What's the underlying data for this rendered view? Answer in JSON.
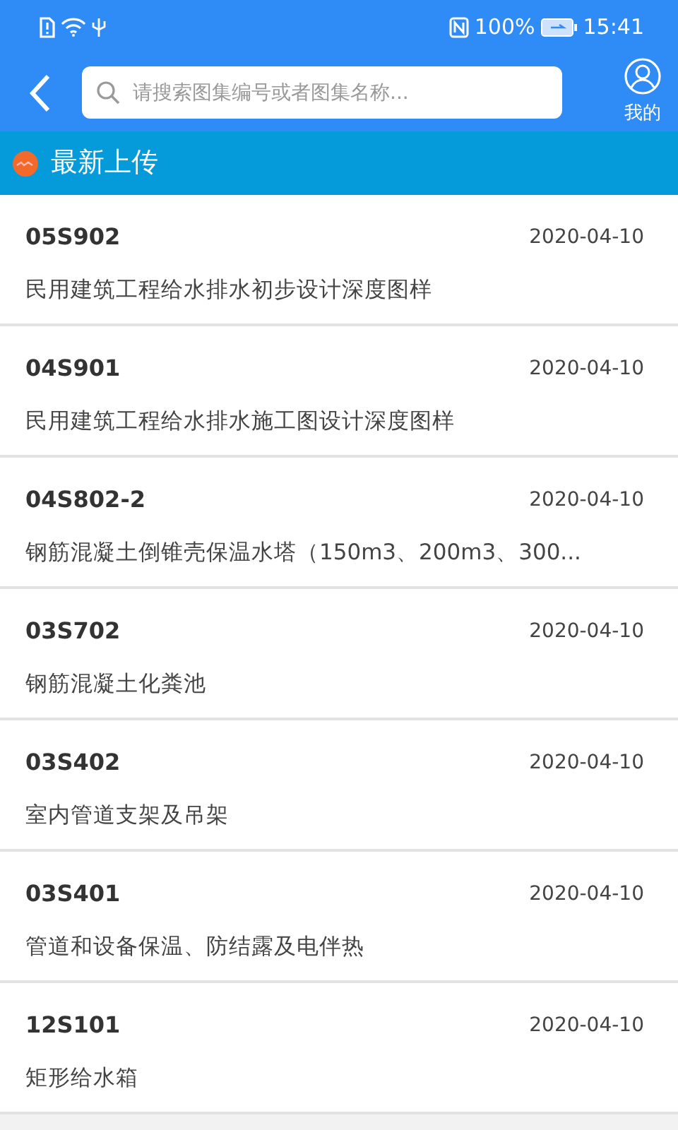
{
  "status_bar": {
    "battery_text": "100%",
    "time": "15:41"
  },
  "header": {
    "search": {
      "placeholder": "请搜索图集编号或者图集名称..."
    },
    "profile_label": "我的"
  },
  "section": {
    "title": "最新上传"
  },
  "items": [
    {
      "code": "05S902",
      "date": "2020-04-10",
      "title": "民用建筑工程给水排水初步设计深度图样"
    },
    {
      "code": "04S901",
      "date": "2020-04-10",
      "title": "民用建筑工程给水排水施工图设计深度图样"
    },
    {
      "code": "04S802-2",
      "date": "2020-04-10",
      "title": "钢筋混凝土倒锥壳保温水塔（150m3、200m3、300..."
    },
    {
      "code": "03S702",
      "date": "2020-04-10",
      "title": "钢筋混凝土化粪池"
    },
    {
      "code": "03S402",
      "date": "2020-04-10",
      "title": "室内管道支架及吊架"
    },
    {
      "code": "03S401",
      "date": "2020-04-10",
      "title": "管道和设备保温、防结露及电伴热"
    },
    {
      "code": "12S101",
      "date": "2020-04-10",
      "title": "矩形给水箱"
    }
  ]
}
